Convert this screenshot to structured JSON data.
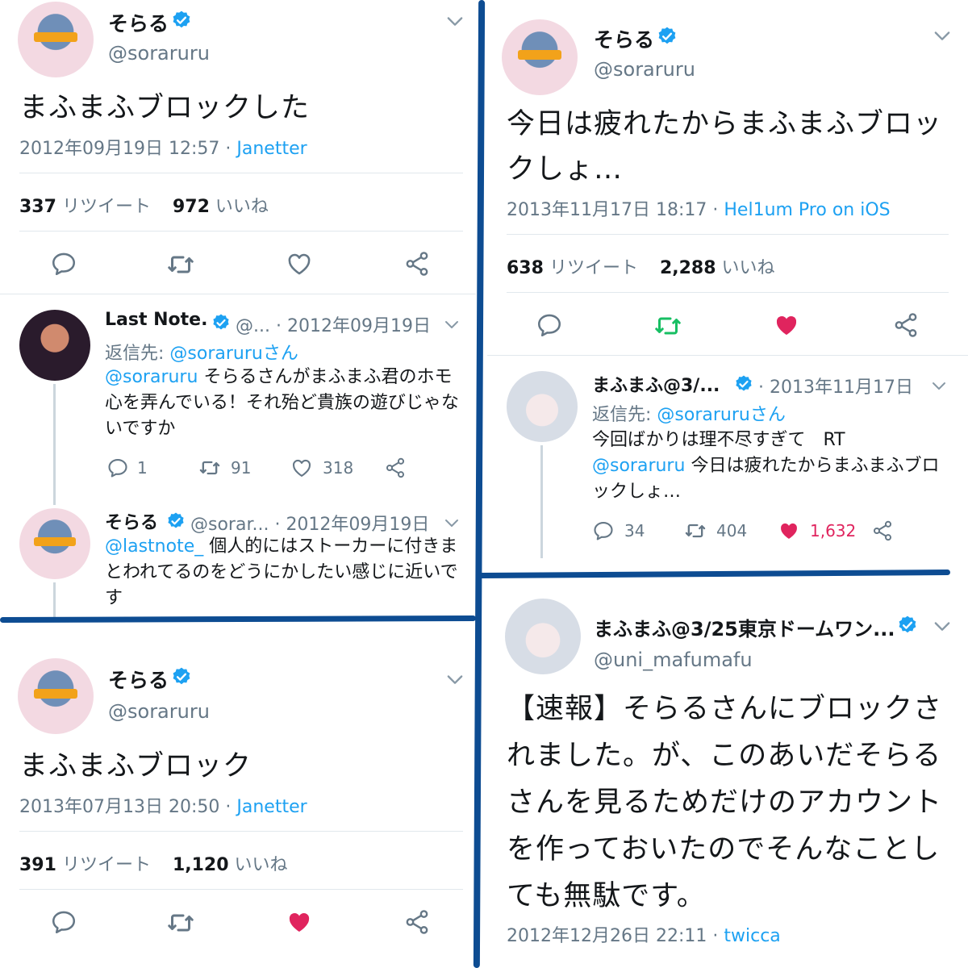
{
  "colors": {
    "blue": "#1da1f2",
    "gray": "#657786",
    "like": "#e0245e",
    "retweet": "#17bf63",
    "divider": "#0d4c92"
  },
  "tl": {
    "name": "そらる",
    "handle": "@soraruru",
    "text": "まふまふブロックした",
    "date": "2012年09月19日 12:57",
    "sep": "·",
    "client": "Janetter",
    "rt_count": "337",
    "rt_label": "リツイート",
    "like_count": "972",
    "like_label": "いいね",
    "reply1": {
      "name": "Last Note.",
      "handle": "@...",
      "date": "· 2012年09月19日",
      "replying_label": "返信先:",
      "replying_to": "@soraruruさん",
      "mention": "@soraruru",
      "text": "そらるさんがまふまふ君のホモ心を弄んでいる！それ殆ど貴族の遊びじゃないですか",
      "replies": "1",
      "retweets": "91",
      "likes": "318"
    },
    "reply2": {
      "name": "そらる",
      "handle": "@sorar...",
      "date": "· 2012年09月19日",
      "mention": "@lastnote_",
      "text": "個人的にはストーカーに付きまとわれてるのをどうにかしたい感じに近いです"
    }
  },
  "bl": {
    "name": "そらる",
    "handle": "@soraruru",
    "text": "まふまふブロック",
    "date": "2013年07月13日 20:50",
    "sep": "·",
    "client": "Janetter",
    "rt_count": "391",
    "rt_label": "リツイート",
    "like_count": "1,120",
    "like_label": "いいね"
  },
  "tr": {
    "name": "そらる",
    "handle": "@soraruru",
    "text": "今日は疲れたからまふまふブロックしょ…",
    "date": "2013年11月17日 18:17",
    "sep": "·",
    "client": "Hel1um Pro on iOS",
    "rt_count": "638",
    "rt_label": "リツイート",
    "like_count": "2,288",
    "like_label": "いいね",
    "reply": {
      "name": "まふまふ@3/...",
      "date": "· 2013年11月17日",
      "replying_label": "返信先:",
      "replying_to": "@soraruruさん",
      "line1": "今回ばかりは理不尽すぎて　RT",
      "mention": "@soraruru",
      "text": "今日は疲れたからまふまふブロックしょ…",
      "replies": "34",
      "retweets": "404",
      "likes": "1,632"
    }
  },
  "br": {
    "name": "まふまふ@3/25東京ドームワン...",
    "handle": "@uni_mafumafu",
    "text": "【速報】そらるさんにブロックされました。が、このあいだそらるさんを見るためだけのアカウントを作っておいたのでそんなことしても無駄です。",
    "date": "2012年12月26日 22:11",
    "sep": "·",
    "client": "twicca"
  }
}
